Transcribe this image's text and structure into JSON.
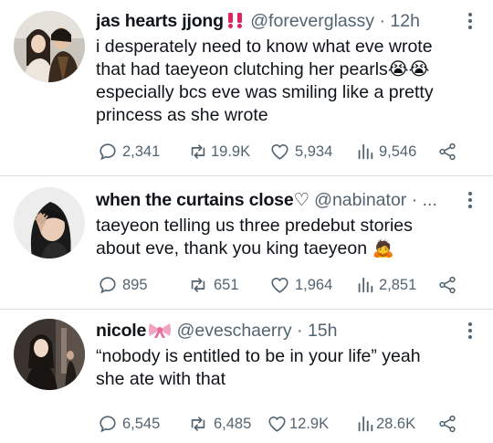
{
  "tweets": [
    {
      "name": "jas hearts jjong",
      "name_emoji": "‼️",
      "handle": "@foreverglassy",
      "dot": "·",
      "time": "12h",
      "text_lines": [
        "i desperately need to know what eve wrote",
        "that had taeyeon clutching her pearls😭😭",
        "especially bcs eve was smiling like a pretty",
        "princess as she wrote"
      ],
      "replies": "2,341",
      "retweets": "19.9K",
      "likes": "5,934",
      "views": "9,546"
    },
    {
      "name": "when the curtains close♡",
      "handle": "@nabinator",
      "dot": "·",
      "time": "...",
      "text_lines": [
        "taeyeon telling us three predebut stories",
        "about eve, thank you king taeyeon 🙇"
      ],
      "replies": "895",
      "retweets": "651",
      "likes": "1,964",
      "views": "2,851"
    },
    {
      "name": "nicole",
      "name_emoji": "🎀",
      "handle": "@eveschaerry",
      "dot": "·",
      "time": "15h",
      "text_lines": [
        "“nobody is entitled to be in your life” yeah",
        "she ate with that"
      ],
      "replies": "6,545",
      "retweets": "6,485",
      "likes": "12.9K",
      "views": "28.6K"
    }
  ],
  "colors": {
    "text": "#0f1419",
    "secondary": "#536471",
    "divider": "#d9dee2",
    "emphasis_red": "#e0245e"
  },
  "icons": [
    "reply-icon",
    "retweet-icon",
    "like-icon",
    "views-icon",
    "share-icon",
    "more-icon"
  ]
}
